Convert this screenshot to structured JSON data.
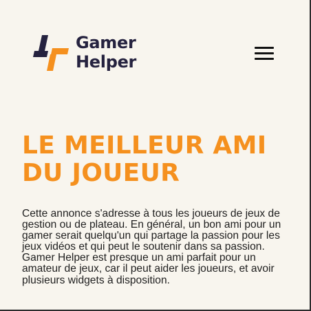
{
  "brand": {
    "name_line1": "Gamer",
    "name_line2": "Helper",
    "colors": {
      "navy": "#25223f",
      "orange": "#f5901e",
      "background": "#f8f5ee"
    },
    "logo_icon": "plus-slash-logo-icon"
  },
  "nav": {
    "menu_icon": "hamburger-menu-icon"
  },
  "hero": {
    "title_line1": "LE MEILLEUR AMI",
    "title_line2": "DU JOUEUR",
    "description": "Cette annonce s'adresse à tous les joueurs de jeux de gestion ou de plateau. En général, un bon ami pour un gamer serait quelqu'un qui partage la passion pour les jeux vidéos et qui peut le soutenir dans sa passion. Gamer Helper est presque un ami parfait pour un amateur de jeux, car il peut aider les joueurs, et avoir plusieurs widgets à disposition."
  }
}
